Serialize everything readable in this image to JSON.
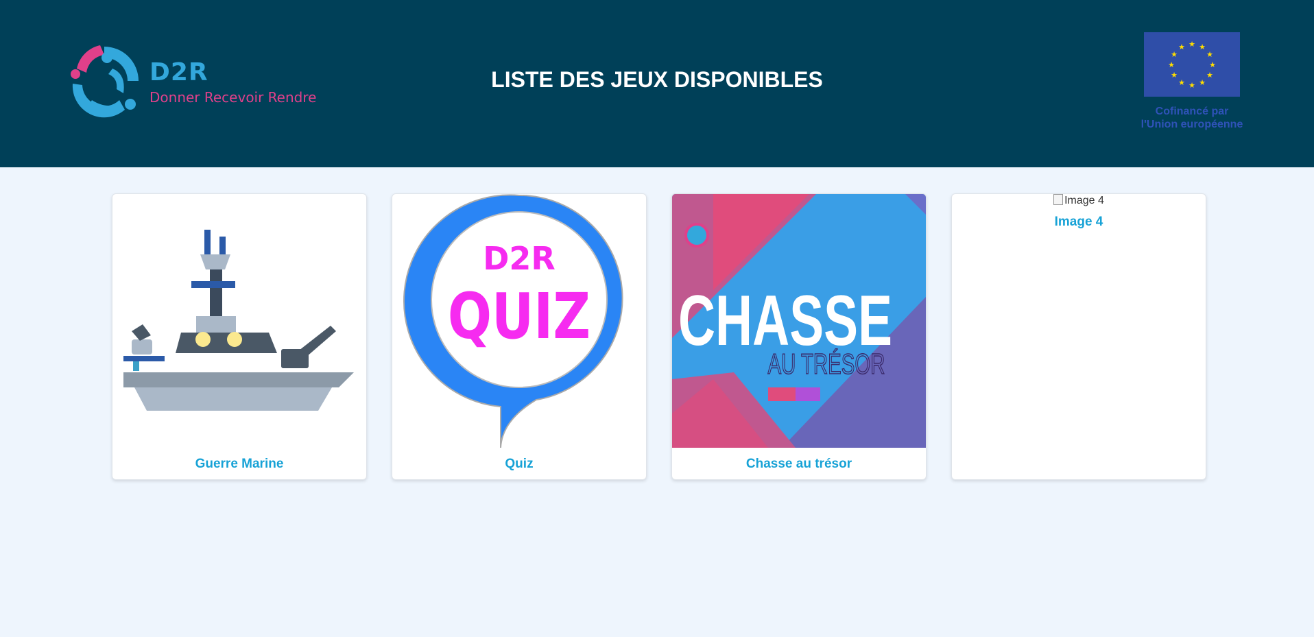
{
  "header": {
    "logo": {
      "name": "D2R",
      "tagline": "Donner Recevoir Rendre"
    },
    "title": "LISTE DES JEUX DISPONIBLES",
    "funding": {
      "line1": "Cofinancé par",
      "line2": "l'Union européenne"
    }
  },
  "games": [
    {
      "title": "Guerre Marine",
      "image": "warship-illustration"
    },
    {
      "title": "Quiz",
      "image": "d2r-quiz-bubble",
      "image_text": {
        "line1": "D2R",
        "line2": "QUIZ"
      }
    },
    {
      "title": "Chasse au trésor",
      "image": "treasure-hunt-poster",
      "image_text": {
        "line1": "CHASSE",
        "line2": "AU TRÉSOR"
      }
    },
    {
      "title": "Image 4",
      "image_alt": "Image 4",
      "image": "broken-image"
    }
  ],
  "colors": {
    "header_bg": "#004058",
    "page_bg": "#eef5fd",
    "card_title": "#17a2d6",
    "logo_blue": "#33a8dc",
    "logo_pink": "#e0408a",
    "quiz_pink": "#f62bf0",
    "eu_blue": "#2f4ea8"
  }
}
